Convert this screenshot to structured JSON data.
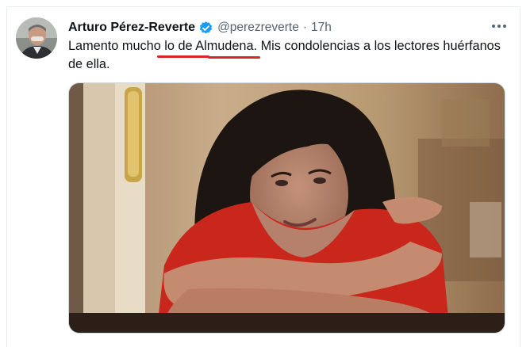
{
  "tweet": {
    "author_name": "Arturo Pérez-Reverte",
    "handle": "@perezreverte",
    "separator": "·",
    "time": "17h",
    "text_line1_part1": "Lamento mucho ",
    "text_line1_highlight": "lo de Almudena",
    "text_line1_part2": ". Mis condolencias a los lectores huérfanos",
    "text_line2": "de ella."
  },
  "icons": {
    "verified": "verified-badge-icon",
    "more": "more-options-icon"
  },
  "colors": {
    "verified_blue": "#1d9bf0",
    "annotation_red": "#d8262b",
    "handle_gray": "#536471"
  }
}
